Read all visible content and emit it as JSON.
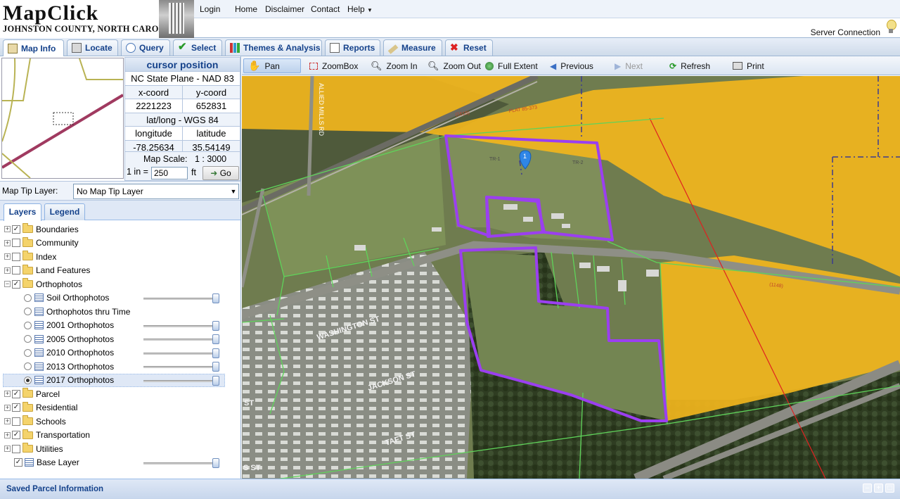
{
  "header": {
    "logo_title": "MapClick",
    "logo_subtitle": "JOHNSTON COUNTY, NORTH CAROLINA",
    "menu": [
      "Login",
      "Home",
      "Disclaimer",
      "Contact",
      "Help"
    ],
    "server_status": "Server Connection"
  },
  "tabs": [
    "Map Info",
    "Locate",
    "Query",
    "Select",
    "Themes & Analysis",
    "Reports",
    "Measure",
    "Reset"
  ],
  "cursor": {
    "title": "cursor position",
    "plane": "NC State Plane - NAD 83",
    "xcoord_label": "x-coord",
    "ycoord_label": "y-coord",
    "xcoord": "2221223",
    "ycoord": "652831",
    "latlong_label": "lat/long - WGS 84",
    "longitude_label": "longitude",
    "latitude_label": "latitude",
    "longitude": "-78.25634",
    "latitude": "35.54149",
    "scale_label": "Map Scale:",
    "scale_value": "1 : 3000",
    "inch_label": "1 in =",
    "inch_value": "250",
    "unit": "ft",
    "go_label": "Go"
  },
  "map_tip": {
    "label": "Map Tip Layer:",
    "value": "No Map Tip Layer"
  },
  "layer_tabs": [
    "Layers",
    "Legend"
  ],
  "layers": [
    {
      "name": "Boundaries",
      "checked": true
    },
    {
      "name": "Community",
      "checked": false
    },
    {
      "name": "Index",
      "checked": false
    },
    {
      "name": "Land Features",
      "checked": false
    },
    {
      "name": "Orthophotos",
      "checked": true
    },
    {
      "name": "Parcel",
      "checked": true
    },
    {
      "name": "Residential",
      "checked": true
    },
    {
      "name": "Schools",
      "checked": false
    },
    {
      "name": "Transportation",
      "checked": true
    },
    {
      "name": "Utilities",
      "checked": false
    },
    {
      "name": "Base Layer",
      "checked": true
    }
  ],
  "orthophotos": [
    "Soil Orthophotos",
    "Orthophotos thru Time",
    "2001 Orthophotos",
    "2005 Orthophotos",
    "2010 Orthophotos",
    "2013 Orthophotos",
    "2017 Orthophotos"
  ],
  "selected_orthophoto": "2017 Orthophotos",
  "map_tools": [
    "Pan",
    "ZoomBox",
    "Zoom In",
    "Zoom Out",
    "Full Extent",
    "Previous",
    "Next",
    "Refresh",
    "Print"
  ],
  "map_labels": {
    "road_allied": "ALLIED MILLS RD",
    "washington": "WASHINGTON ST",
    "jackson": "JACKSON ST",
    "taft": "TAFT ST",
    "s_st": "ST",
    "s_st2": "S ST",
    "plat": "PLAT 85-373",
    "lot_1615": "(1615)",
    "lot_1148": "(1148)",
    "tr1": "TR-1",
    "tr2": "TR-2",
    "marker": "1"
  },
  "colors": {
    "accent_blue": "#15428b",
    "parcel_highlight": "#9b3ff0",
    "zone_yellow": "#f2b51c",
    "parcel_line": "#5fd35a"
  },
  "footer": {
    "label": "Saved Parcel Information"
  }
}
